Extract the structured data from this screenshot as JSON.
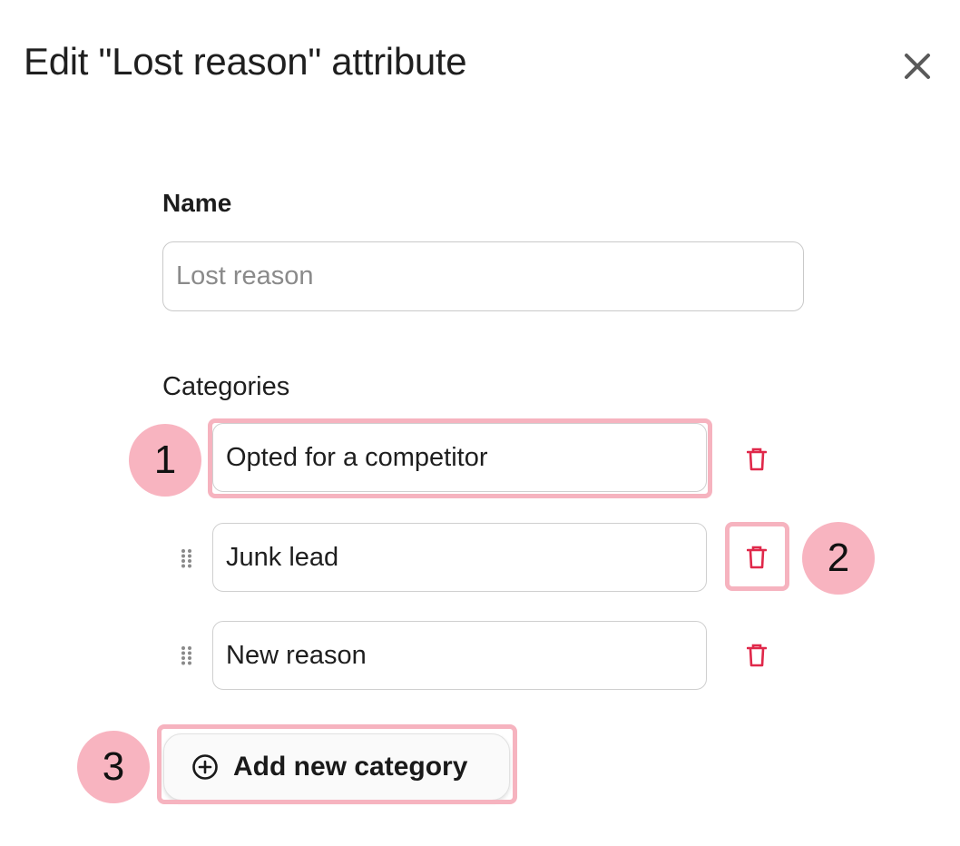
{
  "dialog": {
    "title": "Edit \"Lost reason\" attribute",
    "close_icon": "close-icon"
  },
  "name_field": {
    "label": "Name",
    "placeholder": "Lost reason",
    "value": ""
  },
  "categories": {
    "label": "Categories",
    "items": [
      {
        "value": "Opted for a competitor"
      },
      {
        "value": "Junk lead"
      },
      {
        "value": "New reason"
      }
    ],
    "add_button_label": "Add new category"
  },
  "markers": [
    "1",
    "2",
    "3"
  ],
  "colors": {
    "delete": "#e0284a",
    "highlight": "#f6b3bf",
    "marker": "#f8b4c0"
  }
}
